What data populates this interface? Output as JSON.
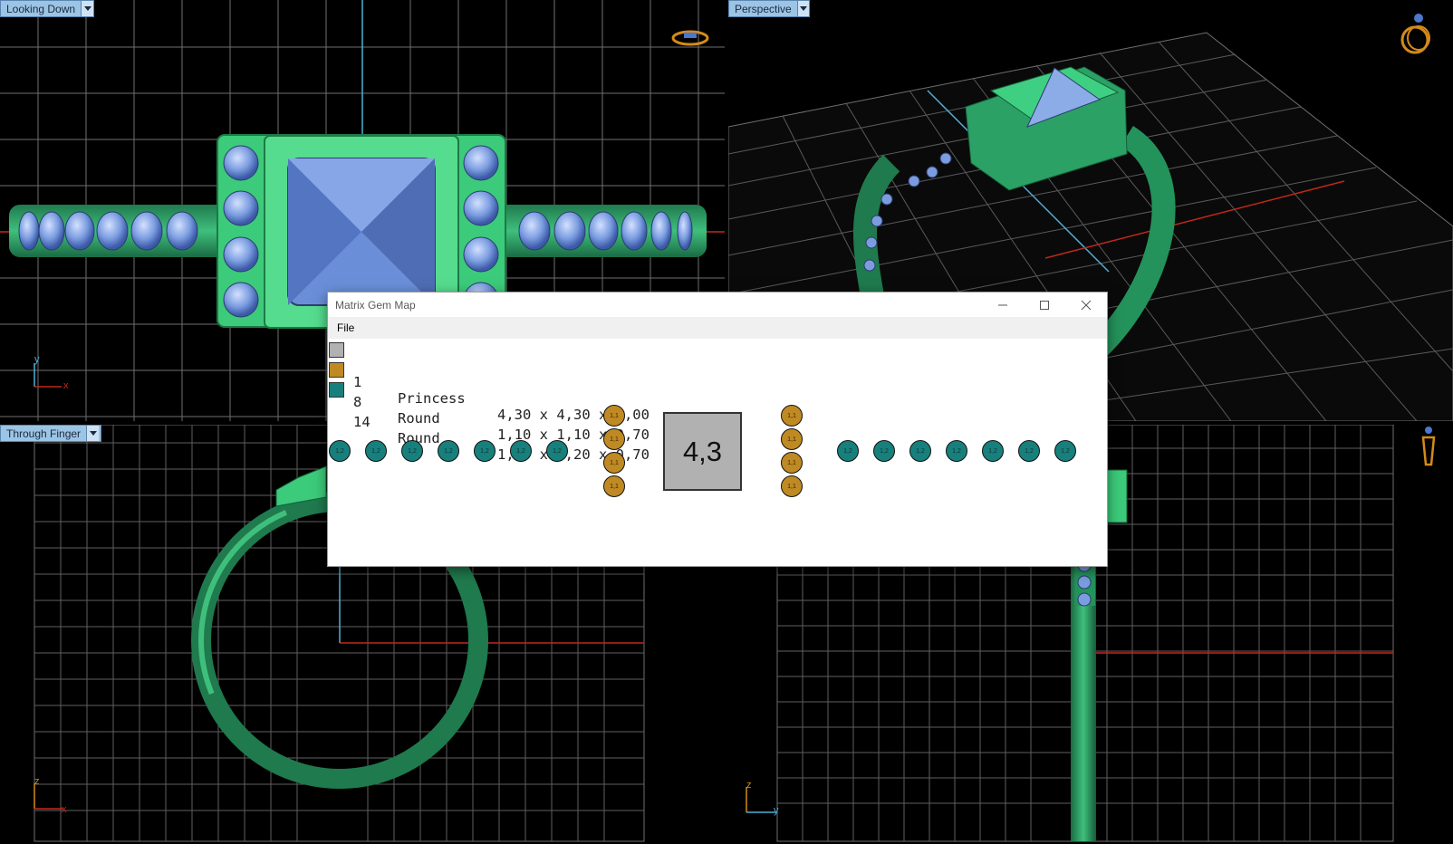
{
  "viewports": {
    "top_left": {
      "label": "Looking Down",
      "axis_h": "x",
      "axis_v": "y"
    },
    "top_right": {
      "label": "Perspective"
    },
    "bottom_left": {
      "label": "Through Finger",
      "axis_h": "x",
      "axis_v": "z"
    },
    "bottom_right": {
      "axis_h": "y",
      "axis_v": "z"
    }
  },
  "dialog": {
    "title": "Matrix Gem Map",
    "menu": {
      "file": "File"
    },
    "legend": [
      {
        "count": "1",
        "shape": "Princess",
        "dims": "4,30 x 4,30 x 3,00",
        "color": "#b1b1b1"
      },
      {
        "count": "8",
        "shape": "Round",
        "dims": "1,10 x 1,10 x 0,70",
        "color": "#bf8a23"
      },
      {
        "count": "14",
        "shape": "Round",
        "dims": "1,20 x 1,20 x 0,70",
        "color": "#17807d"
      }
    ],
    "gem_map": {
      "center_label": "4,3",
      "left_row": [
        "1,2",
        "1,2",
        "1,2",
        "1,2",
        "1,2",
        "1,2",
        "1,2"
      ],
      "right_row": [
        "1,2",
        "1,2",
        "1,2",
        "1,2",
        "1,2",
        "1,2",
        "1,2"
      ],
      "left_column": [
        "1,1",
        "1,1",
        "1,1",
        "1,1"
      ],
      "right_column": [
        "1,1",
        "1,1",
        "1,1",
        "1,1"
      ]
    }
  },
  "colors": {
    "metal_green": "#2d9a66",
    "stone_blue": "#7b9de0",
    "grid": "#7a7a7a",
    "axis_red": "#c0281c",
    "axis_cyan": "#4fb0d8",
    "viewport_tab": "#9cc4e4"
  },
  "icons": [
    "chevron-down-icon",
    "ring-view-icon",
    "minimize-icon",
    "maximize-icon",
    "close-icon"
  ]
}
